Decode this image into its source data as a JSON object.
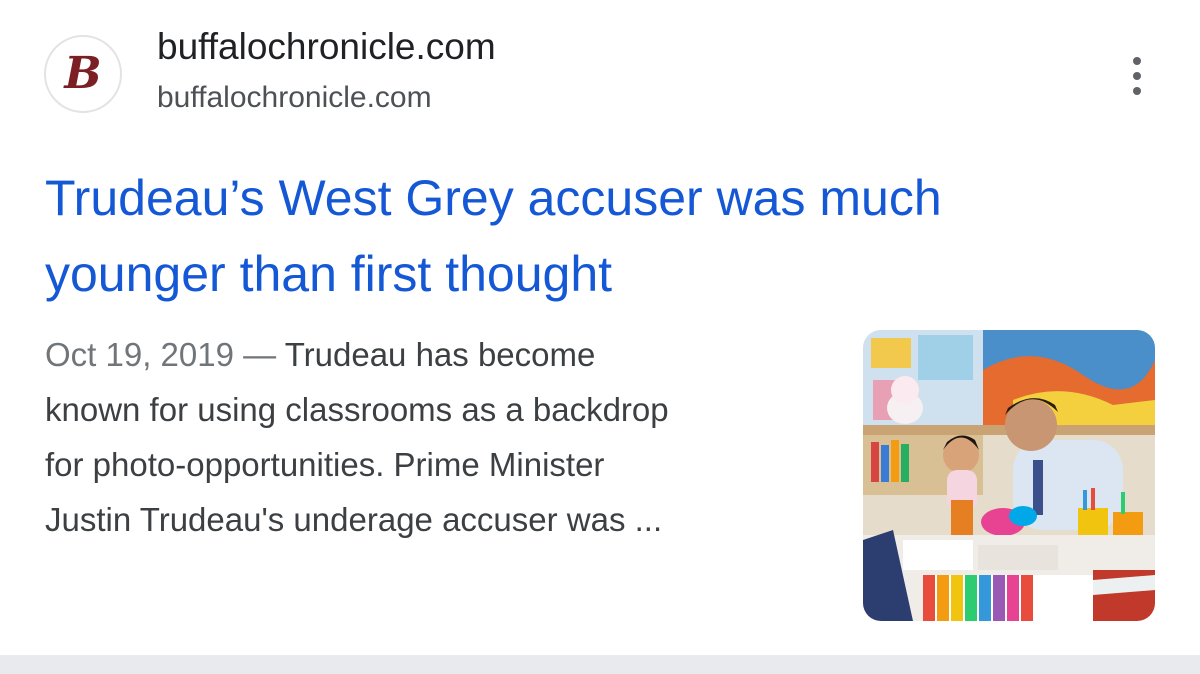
{
  "source": {
    "favicon_letter": "B",
    "name": "buffalochronicle.com",
    "url": "buffalochronicle.com",
    "menu_icon": "more-vert-icon"
  },
  "result": {
    "title_line1": "Trudeau’s West Grey accuser was much",
    "title_line2": "younger than first thought",
    "date": "Oct 19, 2019",
    "separator": " — ",
    "snippet_line1": "Trudeau has become",
    "snippet_line2": "known for using classrooms as a backdrop",
    "snippet_line3": "for photo-opportunities. Prime Minister",
    "snippet_line4": "Justin Trudeau's underage accuser was ..."
  },
  "colors": {
    "title_link": "#1558d6",
    "snippet_text": "#3c4043",
    "favicon_accent": "#7c1f24"
  }
}
